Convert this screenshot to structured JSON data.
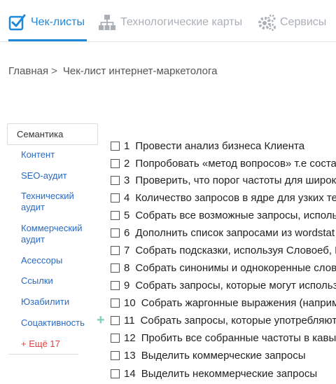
{
  "nav": {
    "tabs": [
      {
        "label": "Чек-листы",
        "icon": "checkbox-icon",
        "active": true
      },
      {
        "label": "Технологические карты",
        "icon": "hierarchy-icon",
        "active": false
      },
      {
        "label": "Сервисы",
        "icon": "gears-icon",
        "active": false
      }
    ]
  },
  "breadcrumb": {
    "home": "Главная",
    "separator": ">",
    "current": "Чек-лист интернет-маркетолога"
  },
  "sidebar": {
    "active": "Семантика",
    "items": [
      {
        "label": "Контент"
      },
      {
        "label": "SEO-аудит"
      },
      {
        "label": "Технический аудит"
      },
      {
        "label": "Коммерческий аудит"
      },
      {
        "label": "Асессоры"
      },
      {
        "label": "Ссылки"
      },
      {
        "label": "Юзабилити"
      },
      {
        "label": "Соцактивность"
      }
    ],
    "more": "+ Ещё 17"
  },
  "checklist": [
    {
      "num": "1",
      "text": "Провести анализ бизнеса Клиента"
    },
    {
      "num": "2",
      "text": "Попробовать «метод вопросов» т.е составить"
    },
    {
      "num": "3",
      "text": "Проверить, что порог частоты для широких"
    },
    {
      "num": "4",
      "text": "Количество запросов в ядре для узких тем"
    },
    {
      "num": "5",
      "text": "Собрать все возможные запросы, используя"
    },
    {
      "num": "6",
      "text": "Дополнить список запросами из wordstat"
    },
    {
      "num": "7",
      "text": "Собрать подсказки, используя Словоеб, К"
    },
    {
      "num": "8",
      "text": "Собрать синонимы и однокоренные слова"
    },
    {
      "num": "9",
      "text": "Собрать запросы, которые могут использ"
    },
    {
      "num": "10",
      "text": "Собрать жаргонные выражения (наприм"
    },
    {
      "num": "11",
      "text": "Собрать запросы, которые употребляют"
    },
    {
      "num": "12",
      "text": "Пробить все собранные частоты в кавыч"
    },
    {
      "num": "13",
      "text": "Выделить коммерческие запросы"
    },
    {
      "num": "14",
      "text": "Выделить некоммерческие запросы"
    }
  ],
  "add_symbol": "+",
  "colors": {
    "accent": "#1e88d9",
    "muted": "#aab0b6",
    "link": "#2a6bc2",
    "more": "#e04040",
    "plus": "#7fcfbf"
  }
}
